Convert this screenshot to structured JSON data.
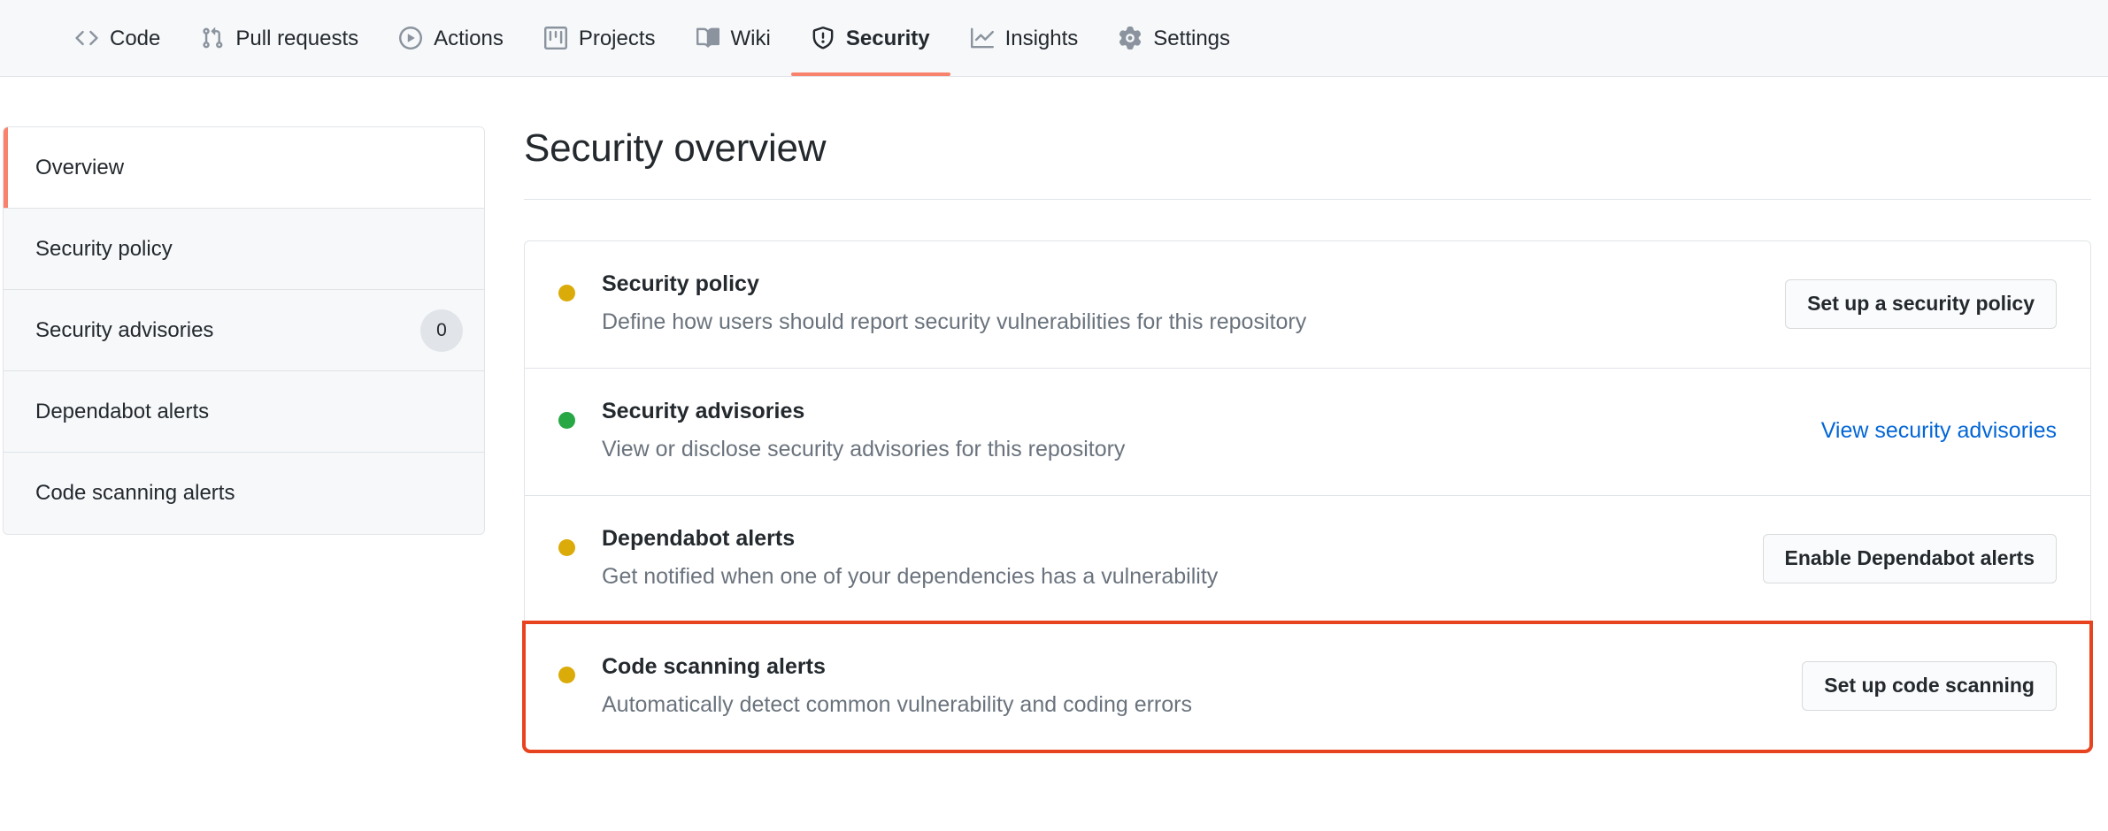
{
  "nav": {
    "items": [
      {
        "label": "Code",
        "icon": "code-icon",
        "active": false
      },
      {
        "label": "Pull requests",
        "icon": "git-pull-request-icon",
        "active": false
      },
      {
        "label": "Actions",
        "icon": "play-circle-icon",
        "active": false
      },
      {
        "label": "Projects",
        "icon": "project-board-icon",
        "active": false
      },
      {
        "label": "Wiki",
        "icon": "book-icon",
        "active": false
      },
      {
        "label": "Security",
        "icon": "shield-alert-icon",
        "active": true
      },
      {
        "label": "Insights",
        "icon": "graph-icon",
        "active": false
      },
      {
        "label": "Settings",
        "icon": "gear-icon",
        "active": false
      }
    ],
    "active_underline_color": "#f9826c"
  },
  "sidebar": {
    "items": [
      {
        "label": "Overview",
        "badge": null,
        "selected": true
      },
      {
        "label": "Security policy",
        "badge": null,
        "selected": false
      },
      {
        "label": "Security advisories",
        "badge": "0",
        "selected": false
      },
      {
        "label": "Dependabot alerts",
        "badge": null,
        "selected": false
      },
      {
        "label": "Code scanning alerts",
        "badge": null,
        "selected": false
      }
    ],
    "selected_accent_color": "#f9826c"
  },
  "main": {
    "title": "Security overview",
    "cards": [
      {
        "title": "Security policy",
        "description": "Define how users should report security vulnerabilities for this repository",
        "dot_color": "#dbab09",
        "action_type": "button",
        "action_label": "Set up a security policy",
        "highlighted": false
      },
      {
        "title": "Security advisories",
        "description": "View or disclose security advisories for this repository",
        "dot_color": "#28a745",
        "action_type": "link",
        "action_label": "View security advisories",
        "highlighted": false
      },
      {
        "title": "Dependabot alerts",
        "description": "Get notified when one of your dependencies has a vulnerability",
        "dot_color": "#dbab09",
        "action_type": "button",
        "action_label": "Enable Dependabot alerts",
        "highlighted": false
      },
      {
        "title": "Code scanning alerts",
        "description": "Automatically detect common vulnerability and coding errors",
        "dot_color": "#dbab09",
        "action_type": "button",
        "action_label": "Set up code scanning",
        "highlighted": true,
        "highlight_color": "#e8431f"
      }
    ]
  }
}
